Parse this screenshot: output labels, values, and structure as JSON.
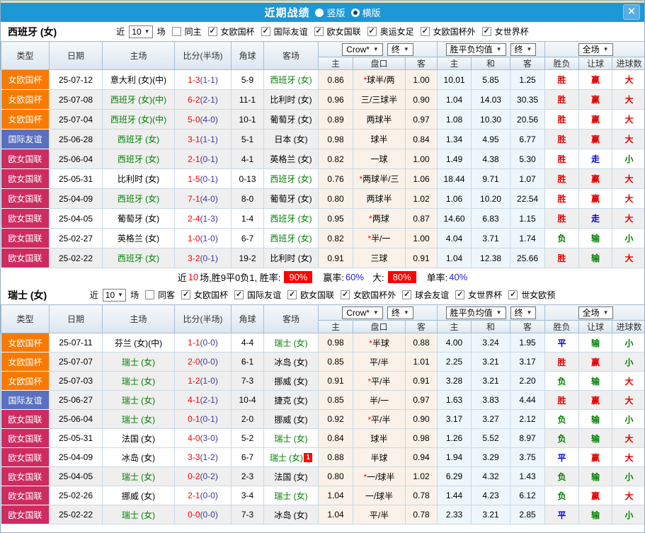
{
  "titlebar": {
    "title": "近期战绩",
    "radios": [
      {
        "label": "竖版",
        "selected": false
      },
      {
        "label": "横版",
        "selected": true
      }
    ],
    "close_label": "✕"
  },
  "table_header": {
    "left": [
      "类型",
      "日期",
      "主场",
      "比分(半场)",
      "角球",
      "客场"
    ],
    "groups": [
      {
        "selects": [
          "Crow*",
          "终"
        ],
        "sub": [
          "主",
          "盘口",
          "客"
        ]
      },
      {
        "selects": [
          "胜平负均值",
          "终"
        ],
        "sub": [
          "主",
          "和",
          "客"
        ]
      },
      {
        "selects": [
          "全场"
        ],
        "sub": [
          "胜负",
          "让球",
          "进球数"
        ]
      }
    ]
  },
  "league_colors": {
    "女欧国杯": "#F97A02",
    "国际友谊": "#5A6FC0",
    "欧女国联": "#CE2B61"
  },
  "result_colors": {
    "胜": "#E60000",
    "赢": "#E60000",
    "大": "#E60000",
    "平": "#0000D9",
    "走": "#0000D9",
    "负": "#008000",
    "输": "#008000",
    "小": "#008000"
  },
  "sections": [
    {
      "team": "西班牙 (女)",
      "filter": {
        "near": "近",
        "count": "10",
        "unit": "场",
        "same": {
          "label": "同主",
          "checked": false
        },
        "leagues": [
          {
            "label": "女欧国杯",
            "checked": true
          },
          {
            "label": "国际友谊",
            "checked": true
          },
          {
            "label": "欧女国联",
            "checked": true
          },
          {
            "label": "奥运女足",
            "checked": true
          },
          {
            "label": "女欧国杯外",
            "checked": true
          },
          {
            "label": "女世界杯",
            "checked": true
          }
        ]
      },
      "rows": [
        {
          "league": "女欧国杯",
          "date": "25-07-12",
          "home": "意大利 (女)(中)",
          "home_focal": false,
          "score": "1-3",
          "half": "(1-1)",
          "corner": "5-9",
          "away": "西班牙 (女)",
          "away_focal": true,
          "away_badge": "",
          "odds_home": "0.86",
          "handicap_star": true,
          "handicap": "球半/两",
          "odds_away": "1.00",
          "avg_home": "10.01",
          "avg_draw": "5.85",
          "avg_away": "1.25",
          "result": "胜",
          "handicap_result": "赢",
          "goals_result": "大"
        },
        {
          "league": "女欧国杯",
          "date": "25-07-08",
          "home": "西班牙 (女)(中)",
          "home_focal": true,
          "score": "6-2",
          "half": "(2-1)",
          "corner": "11-1",
          "away": "比利时 (女)",
          "away_focal": false,
          "away_badge": "",
          "odds_home": "0.96",
          "handicap_star": false,
          "handicap": "三/三球半",
          "odds_away": "0.90",
          "avg_home": "1.04",
          "avg_draw": "14.03",
          "avg_away": "30.35",
          "result": "胜",
          "handicap_result": "赢",
          "goals_result": "大"
        },
        {
          "league": "女欧国杯",
          "date": "25-07-04",
          "home": "西班牙 (女)(中)",
          "home_focal": true,
          "score": "5-0",
          "half": "(4-0)",
          "corner": "10-1",
          "away": "葡萄牙 (女)",
          "away_focal": false,
          "away_badge": "",
          "odds_home": "0.89",
          "handicap_star": false,
          "handicap": "两球半",
          "odds_away": "0.97",
          "avg_home": "1.08",
          "avg_draw": "10.30",
          "avg_away": "20.56",
          "result": "胜",
          "handicap_result": "赢",
          "goals_result": "大"
        },
        {
          "league": "国际友谊",
          "date": "25-06-28",
          "home": "西班牙 (女)",
          "home_focal": true,
          "score": "3-1",
          "half": "(1-1)",
          "corner": "5-1",
          "away": "日本 (女)",
          "away_focal": false,
          "away_badge": "",
          "odds_home": "0.98",
          "handicap_star": false,
          "handicap": "球半",
          "odds_away": "0.84",
          "avg_home": "1.34",
          "avg_draw": "4.95",
          "avg_away": "6.77",
          "result": "胜",
          "handicap_result": "赢",
          "goals_result": "大"
        },
        {
          "league": "欧女国联",
          "date": "25-06-04",
          "home": "西班牙 (女)",
          "home_focal": true,
          "score": "2-1",
          "half": "(0-1)",
          "corner": "4-1",
          "away": "英格兰 (女)",
          "away_focal": false,
          "away_badge": "",
          "odds_home": "0.82",
          "handicap_star": false,
          "handicap": "一球",
          "odds_away": "1.00",
          "avg_home": "1.49",
          "avg_draw": "4.38",
          "avg_away": "5.30",
          "result": "胜",
          "handicap_result": "走",
          "goals_result": "小"
        },
        {
          "league": "欧女国联",
          "date": "25-05-31",
          "home": "比利时 (女)",
          "home_focal": false,
          "score": "1-5",
          "half": "(0-1)",
          "corner": "0-13",
          "away": "西班牙 (女)",
          "away_focal": true,
          "away_badge": "",
          "odds_home": "0.76",
          "handicap_star": true,
          "handicap": "两球半/三",
          "odds_away": "1.06",
          "avg_home": "18.44",
          "avg_draw": "9.71",
          "avg_away": "1.07",
          "result": "胜",
          "handicap_result": "赢",
          "goals_result": "大"
        },
        {
          "league": "欧女国联",
          "date": "25-04-09",
          "home": "西班牙 (女)",
          "home_focal": true,
          "score": "7-1",
          "half": "(4-0)",
          "corner": "8-0",
          "away": "葡萄牙 (女)",
          "away_focal": false,
          "away_badge": "",
          "odds_home": "0.80",
          "handicap_star": false,
          "handicap": "两球半",
          "odds_away": "1.02",
          "avg_home": "1.06",
          "avg_draw": "10.20",
          "avg_away": "22.54",
          "result": "胜",
          "handicap_result": "赢",
          "goals_result": "大"
        },
        {
          "league": "欧女国联",
          "date": "25-04-05",
          "home": "葡萄牙 (女)",
          "home_focal": false,
          "score": "2-4",
          "half": "(1-3)",
          "corner": "1-4",
          "away": "西班牙 (女)",
          "away_focal": true,
          "away_badge": "",
          "odds_home": "0.95",
          "handicap_star": true,
          "handicap": "两球",
          "odds_away": "0.87",
          "avg_home": "14.60",
          "avg_draw": "6.83",
          "avg_away": "1.15",
          "result": "胜",
          "handicap_result": "走",
          "goals_result": "大"
        },
        {
          "league": "欧女国联",
          "date": "25-02-27",
          "home": "英格兰 (女)",
          "home_focal": false,
          "score": "1-0",
          "half": "(1-0)",
          "corner": "6-7",
          "away": "西班牙 (女)",
          "away_focal": true,
          "away_badge": "",
          "odds_home": "0.82",
          "handicap_star": true,
          "handicap": "半/一",
          "odds_away": "1.00",
          "avg_home": "4.04",
          "avg_draw": "3.71",
          "avg_away": "1.74",
          "result": "负",
          "handicap_result": "输",
          "goals_result": "小"
        },
        {
          "league": "欧女国联",
          "date": "25-02-22",
          "home": "西班牙 (女)",
          "home_focal": true,
          "score": "3-2",
          "half": "(0-1)",
          "corner": "19-2",
          "away": "比利时 (女)",
          "away_focal": false,
          "away_badge": "",
          "odds_home": "0.91",
          "handicap_star": false,
          "handicap": "三球",
          "odds_away": "0.91",
          "avg_home": "1.04",
          "avg_draw": "12.38",
          "avg_away": "25.66",
          "result": "胜",
          "handicap_result": "输",
          "goals_result": "大"
        }
      ],
      "summary": {
        "lead": "近",
        "count": "10",
        "tail": "场,胜9平0负1, 胜率:",
        "win_rate": "90%",
        "mid1": "赢率:",
        "win_odds_rate": "60%",
        "mid2": "大:",
        "big_rate": "80%",
        "mid3": "单率:",
        "single_rate": "40%"
      }
    },
    {
      "team": "瑞士 (女)",
      "filter": {
        "near": "近",
        "count": "10",
        "unit": "场",
        "same": {
          "label": "同客",
          "checked": false
        },
        "leagues": [
          {
            "label": "女欧国杯",
            "checked": true
          },
          {
            "label": "国际友谊",
            "checked": true
          },
          {
            "label": "欧女国联",
            "checked": true
          },
          {
            "label": "女欧国杯外",
            "checked": true
          },
          {
            "label": "球会友谊",
            "checked": true
          },
          {
            "label": "女世界杯",
            "checked": true
          },
          {
            "label": "世女欧预",
            "checked": true
          }
        ]
      },
      "rows": [
        {
          "league": "女欧国杯",
          "date": "25-07-11",
          "home": "芬兰 (女)(中)",
          "home_focal": false,
          "score": "1-1",
          "half": "(0-0)",
          "corner": "4-4",
          "away": "瑞士 (女)",
          "away_focal": true,
          "away_badge": "",
          "odds_home": "0.98",
          "handicap_star": true,
          "handicap": "半球",
          "odds_away": "0.88",
          "avg_home": "4.00",
          "avg_draw": "3.24",
          "avg_away": "1.95",
          "result": "平",
          "handicap_result": "输",
          "goals_result": "小"
        },
        {
          "league": "女欧国杯",
          "date": "25-07-07",
          "home": "瑞士 (女)",
          "home_focal": true,
          "score": "2-0",
          "half": "(0-0)",
          "corner": "6-1",
          "away": "冰岛 (女)",
          "away_focal": false,
          "away_badge": "",
          "odds_home": "0.85",
          "handicap_star": false,
          "handicap": "平/半",
          "odds_away": "1.01",
          "avg_home": "2.25",
          "avg_draw": "3.21",
          "avg_away": "3.17",
          "result": "胜",
          "handicap_result": "赢",
          "goals_result": "小"
        },
        {
          "league": "女欧国杯",
          "date": "25-07-03",
          "home": "瑞士 (女)",
          "home_focal": true,
          "score": "1-2",
          "half": "(1-0)",
          "corner": "7-3",
          "away": "挪威 (女)",
          "away_focal": false,
          "away_badge": "",
          "odds_home": "0.91",
          "handicap_star": true,
          "handicap": "平/半",
          "odds_away": "0.91",
          "avg_home": "3.28",
          "avg_draw": "3.21",
          "avg_away": "2.20",
          "result": "负",
          "handicap_result": "输",
          "goals_result": "大"
        },
        {
          "league": "国际友谊",
          "date": "25-06-27",
          "home": "瑞士 (女)",
          "home_focal": true,
          "score": "4-1",
          "half": "(2-1)",
          "corner": "10-4",
          "away": "捷克 (女)",
          "away_focal": false,
          "away_badge": "",
          "odds_home": "0.85",
          "handicap_star": false,
          "handicap": "半/一",
          "odds_away": "0.97",
          "avg_home": "1.63",
          "avg_draw": "3.83",
          "avg_away": "4.44",
          "result": "胜",
          "handicap_result": "赢",
          "goals_result": "大"
        },
        {
          "league": "欧女国联",
          "date": "25-06-04",
          "home": "瑞士 (女)",
          "home_focal": true,
          "score": "0-1",
          "half": "(0-1)",
          "corner": "2-0",
          "away": "挪威 (女)",
          "away_focal": false,
          "away_badge": "",
          "odds_home": "0.92",
          "handicap_star": true,
          "handicap": "平/半",
          "odds_away": "0.90",
          "avg_home": "3.17",
          "avg_draw": "3.27",
          "avg_away": "2.12",
          "result": "负",
          "handicap_result": "输",
          "goals_result": "小"
        },
        {
          "league": "欧女国联",
          "date": "25-05-31",
          "home": "法国 (女)",
          "home_focal": false,
          "score": "4-0",
          "half": "(3-0)",
          "corner": "5-2",
          "away": "瑞士 (女)",
          "away_focal": true,
          "away_badge": "",
          "odds_home": "0.84",
          "handicap_star": false,
          "handicap": "球半",
          "odds_away": "0.98",
          "avg_home": "1.26",
          "avg_draw": "5.52",
          "avg_away": "8.97",
          "result": "负",
          "handicap_result": "输",
          "goals_result": "大"
        },
        {
          "league": "欧女国联",
          "date": "25-04-09",
          "home": "冰岛 (女)",
          "home_focal": false,
          "score": "3-3",
          "half": "(1-2)",
          "corner": "6-7",
          "away": "瑞士 (女)",
          "away_focal": true,
          "away_badge": "1",
          "odds_home": "0.88",
          "handicap_star": false,
          "handicap": "半球",
          "odds_away": "0.94",
          "avg_home": "1.94",
          "avg_draw": "3.29",
          "avg_away": "3.75",
          "result": "平",
          "handicap_result": "赢",
          "goals_result": "大"
        },
        {
          "league": "欧女国联",
          "date": "25-04-05",
          "home": "瑞士 (女)",
          "home_focal": true,
          "score": "0-2",
          "half": "(0-2)",
          "corner": "2-3",
          "away": "法国 (女)",
          "away_focal": false,
          "away_badge": "",
          "odds_home": "0.80",
          "handicap_star": true,
          "handicap": "一/球半",
          "odds_away": "1.02",
          "avg_home": "6.29",
          "avg_draw": "4.32",
          "avg_away": "1.43",
          "result": "负",
          "handicap_result": "输",
          "goals_result": "小"
        },
        {
          "league": "欧女国联",
          "date": "25-02-26",
          "home": "挪威 (女)",
          "home_focal": false,
          "score": "2-1",
          "half": "(0-0)",
          "corner": "3-4",
          "away": "瑞士 (女)",
          "away_focal": true,
          "away_badge": "",
          "odds_home": "1.04",
          "handicap_star": false,
          "handicap": "一/球半",
          "odds_away": "0.78",
          "avg_home": "1.44",
          "avg_draw": "4.23",
          "avg_away": "6.12",
          "result": "负",
          "handicap_result": "赢",
          "goals_result": "大"
        },
        {
          "league": "欧女国联",
          "date": "25-02-22",
          "home": "瑞士 (女)",
          "home_focal": true,
          "score": "0-0",
          "half": "(0-0)",
          "corner": "7-3",
          "away": "冰岛 (女)",
          "away_focal": false,
          "away_badge": "",
          "odds_home": "1.04",
          "handicap_star": false,
          "handicap": "平/半",
          "odds_away": "0.78",
          "avg_home": "2.33",
          "avg_draw": "3.21",
          "avg_away": "2.85",
          "result": "平",
          "handicap_result": "输",
          "goals_result": "小"
        }
      ],
      "summary": null
    }
  ]
}
